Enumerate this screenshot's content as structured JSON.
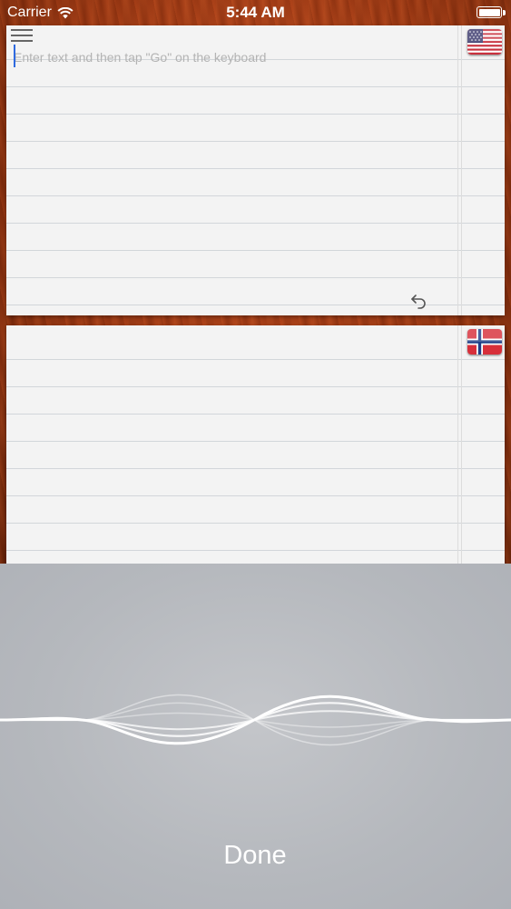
{
  "status_bar": {
    "carrier": "Carrier",
    "time": "5:44 AM",
    "battery_level": 1.0
  },
  "source_panel": {
    "flag": "us-flag-icon",
    "input_value": "",
    "input_placeholder": "Enter text and then tap \"Go\" on the keyboard",
    "undo_icon": "undo-icon",
    "menu_icon": "hamburger-menu-icon"
  },
  "target_panel": {
    "flag": "norway-flag-icon",
    "output_text": ""
  },
  "dictation": {
    "done_label": "Done"
  },
  "colors": {
    "paper": "#f3f3f3",
    "rule_line": "#d2d6da",
    "caret": "#2f6ae0",
    "wood": "#9a3510",
    "dictation_bg": "#b5b8bd",
    "text_on_dictation": "#ffffff"
  }
}
